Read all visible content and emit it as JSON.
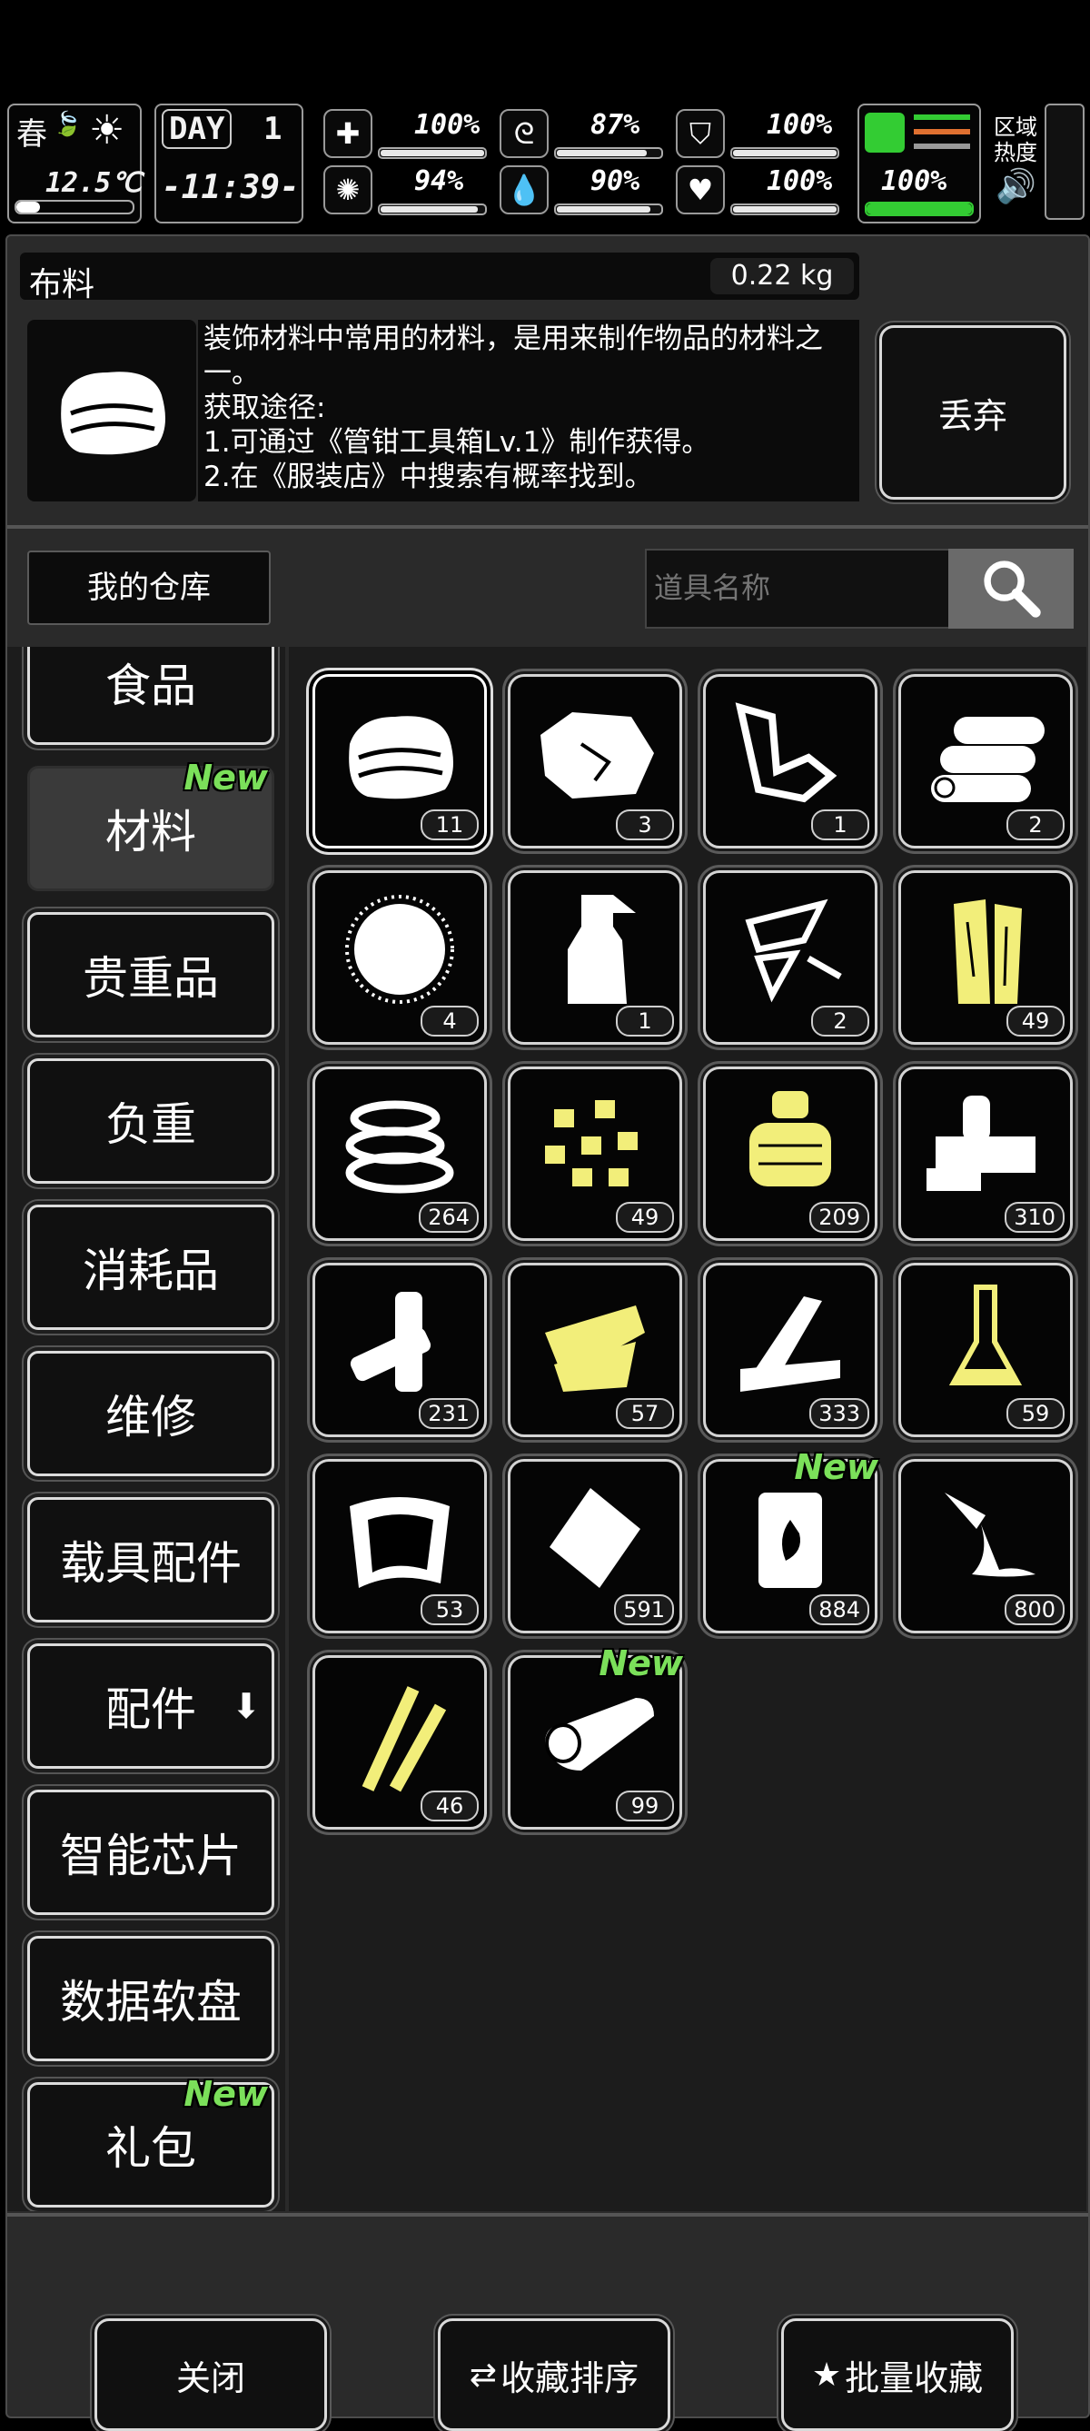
{
  "hud": {
    "season": "春",
    "temperature": "12.5℃",
    "day_label": "DAY",
    "day_number": "1",
    "clock": "-11:39-",
    "zone_label_1": "区域",
    "zone_label_2": "热度",
    "stats": [
      {
        "icon": "medkit-icon",
        "value": "100%",
        "level": 1.0
      },
      {
        "icon": "stomach-icon",
        "value": "87%",
        "level": 0.87
      },
      {
        "icon": "shield-icon",
        "value": "100%",
        "level": 1.0
      },
      {
        "icon": "brain-icon",
        "value": "94%",
        "level": 0.94
      },
      {
        "icon": "water-drop-icon",
        "value": "90%",
        "level": 0.9
      },
      {
        "icon": "heart-icon",
        "value": "100%",
        "level": 1.0
      }
    ],
    "stamina": {
      "value": "100%",
      "level": 1.0,
      "color": "#33cc33"
    }
  },
  "item": {
    "name": "布料",
    "weight": "0.22 kg",
    "description": [
      "装饰材料中常用的材料，是用来制作物品的材料之一。",
      "获取途径:",
      "1.可通过《管钳工具箱Lv.1》制作获得。",
      "2.在《服装店》中搜索有概率找到。"
    ],
    "discard_label": "丢弃"
  },
  "storage": {
    "title": "我的仓库",
    "search_placeholder": "道具名称"
  },
  "categories": [
    {
      "label": "食品",
      "new": false,
      "active": false
    },
    {
      "label": "材料",
      "new": true,
      "active": true
    },
    {
      "label": "贵重品",
      "new": false,
      "active": false
    },
    {
      "label": "负重",
      "new": false,
      "active": false
    },
    {
      "label": "消耗品",
      "new": false,
      "active": false
    },
    {
      "label": "维修",
      "new": false,
      "active": false
    },
    {
      "label": "载具配件",
      "new": false,
      "active": false
    },
    {
      "label": "配件",
      "new": false,
      "active": false,
      "arrow": "⬇"
    },
    {
      "label": "智能芯片",
      "new": false,
      "active": false
    },
    {
      "label": "数据软盘",
      "new": false,
      "active": false
    },
    {
      "label": "礼包",
      "new": true,
      "active": false
    }
  ],
  "new_badge": "New",
  "items": [
    {
      "icon": "cloth-icon",
      "count": "11",
      "selected": true,
      "color": "#ffffff"
    },
    {
      "icon": "rock-ore-icon",
      "count": "3",
      "color": "#ffffff"
    },
    {
      "icon": "scrap-metal-icon",
      "count": "1",
      "color": "#ffffff"
    },
    {
      "icon": "logs-icon",
      "count": "2",
      "color": "#ffffff"
    },
    {
      "icon": "fiber-ball-icon",
      "count": "4",
      "color": "#ffffff"
    },
    {
      "icon": "spray-bottle-icon",
      "count": "1",
      "color": "#ffffff"
    },
    {
      "icon": "glass-shards-icon",
      "count": "2",
      "color": "#ffffff"
    },
    {
      "icon": "wood-planks-icon",
      "count": "49",
      "color": "#f2ee7a"
    },
    {
      "icon": "tape-roll-icon",
      "count": "264",
      "color": "#ffffff"
    },
    {
      "icon": "nuggets-icon",
      "count": "49",
      "color": "#f2ee7a"
    },
    {
      "icon": "spool-icon",
      "count": "209",
      "color": "#f2ee7a"
    },
    {
      "icon": "machine-parts-icon",
      "count": "310",
      "color": "#ffffff"
    },
    {
      "icon": "batteries-icon",
      "count": "231",
      "color": "#ffffff"
    },
    {
      "icon": "circuit-parts-icon",
      "count": "57",
      "color": "#f2ee7a"
    },
    {
      "icon": "lumber-icon",
      "count": "333",
      "color": "#ffffff"
    },
    {
      "icon": "flask-icon",
      "count": "59",
      "color": "#f2ee7a"
    },
    {
      "icon": "plastic-sheet-icon",
      "count": "53",
      "color": "#ffffff"
    },
    {
      "icon": "plastic-bag-icon",
      "count": "591",
      "color": "#ffffff"
    },
    {
      "icon": "fuel-barrel-icon",
      "count": "884",
      "new": true,
      "color": "#ffffff"
    },
    {
      "icon": "glue-pour-icon",
      "count": "800",
      "color": "#ffffff"
    },
    {
      "icon": "copper-wire-icon",
      "count": "46",
      "color": "#f2ee7a"
    },
    {
      "icon": "fabric-roll-icon",
      "count": "99",
      "new": true,
      "color": "#ffffff"
    }
  ],
  "footer": {
    "close_label": "关闭",
    "sort_label": "收藏排序",
    "batch_label": "批量收藏"
  }
}
